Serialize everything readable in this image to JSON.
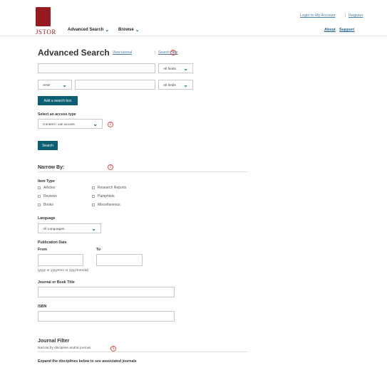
{
  "header": {
    "logo_text": "JSTOR",
    "nav": [
      {
        "label": "Advanced Search"
      },
      {
        "label": "Browse"
      }
    ],
    "top_links": [
      "Login to My Account",
      "Register"
    ],
    "top_sep": "|",
    "sub_links": [
      "About",
      "Support"
    ]
  },
  "page": {
    "title": "Advanced Search",
    "tutorial_link": "View tutorial",
    "help_sep": "|",
    "help_link": "Search Help"
  },
  "markers": [
    "1",
    "2",
    "3",
    "4"
  ],
  "search": {
    "row1_value": "",
    "row1_field": "All fields",
    "row2_operator": "AND",
    "row2_value": "",
    "row2_field": "All fields",
    "add_box_label": "Add a search box"
  },
  "access": {
    "label": "Select an access type",
    "value": "Content I can access"
  },
  "search_button": "Search",
  "narrow": {
    "title": "Narrow By:",
    "item_type_label": "Item Type",
    "item_types_left": [
      "Articles",
      "Reviews",
      "Books"
    ],
    "item_types_right": [
      "Research Reports",
      "Pamphlets",
      "Miscellaneous"
    ],
    "language_label": "Language",
    "language_value": "All Languages",
    "pub_date_label": "Publication Date",
    "from_label": "From",
    "to_label": "To",
    "from_value": "",
    "to_value": "",
    "date_hint": "(yyyy or yyyy/mm or yyyy/mm/dd)",
    "journal_title_label": "Journal or Book Title",
    "journal_title_value": "",
    "isbn_label": "ISBN",
    "isbn_value": ""
  },
  "journal_filter": {
    "title": "Journal Filter",
    "subtitle": "Narrow by discipline and/or journal",
    "expand_text": "Expand the disciplines below to see associated journals"
  },
  "colors": {
    "brand": "#961b1e",
    "button": "#0c5f73",
    "link": "#4a7fa8",
    "marker": "#d9534f"
  }
}
